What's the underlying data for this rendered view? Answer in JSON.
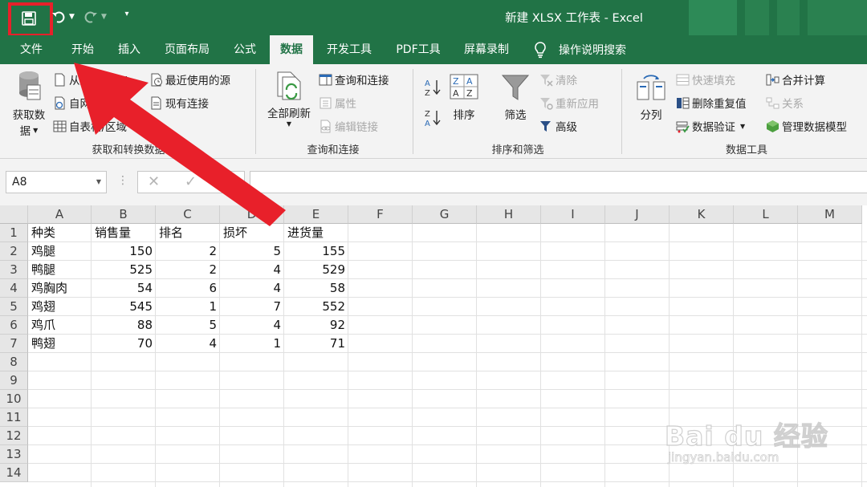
{
  "title_bar": {
    "title": "新建 XLSX 工作表 - Excel"
  },
  "menu": [
    {
      "label": "文件",
      "active": false
    },
    {
      "label": "开始",
      "active": false
    },
    {
      "label": "插入",
      "active": false
    },
    {
      "label": "页面布局",
      "active": false
    },
    {
      "label": "公式",
      "active": false
    },
    {
      "label": "数据",
      "active": true
    },
    {
      "label": "开发工具",
      "active": false
    },
    {
      "label": "PDF工具",
      "active": false
    },
    {
      "label": "屏幕录制",
      "active": false
    },
    {
      "label": "操作说明搜索",
      "active": false
    }
  ],
  "ribbon": {
    "get_data_group": {
      "label": "获取和转换数据",
      "get_data_line1": "获取数",
      "get_data_line2": "据",
      "from_text_csv": "从文本/CSV",
      "from_web": "自网站",
      "from_table": "自表格/区域",
      "recent_sources": "最近使用的源",
      "existing_connections": "现有连接"
    },
    "query_group": {
      "label": "查询和连接",
      "refresh_all": "全部刷新",
      "queries_connections": "查询和连接",
      "properties": "属性",
      "edit_links": "编辑链接"
    },
    "sort_group": {
      "label": "排序和筛选",
      "sort": "排序",
      "filter": "筛选",
      "clear": "清除",
      "reapply": "重新应用",
      "advanced": "高级"
    },
    "data_tools_group": {
      "label": "数据工具",
      "text_to_columns": "分列",
      "flash_fill": "快速填充",
      "remove_duplicates": "删除重复值",
      "data_validation": "数据验证",
      "consolidate": "合并计算",
      "relationships": "关系",
      "manage_data_model": "管理数据模型"
    }
  },
  "formula_bar": {
    "name_box": "A8",
    "formula": ""
  },
  "columns": [
    "A",
    "B",
    "C",
    "D",
    "E",
    "F",
    "G",
    "H",
    "I",
    "J",
    "K",
    "L",
    "M"
  ],
  "rows": [
    "1",
    "2",
    "3",
    "4",
    "5",
    "6",
    "7",
    "8",
    "9",
    "10",
    "11",
    "12",
    "13",
    "14"
  ],
  "table": {
    "headers": [
      "种类",
      "销售量",
      "排名",
      "损坏",
      "进货量"
    ],
    "rows": [
      [
        "鸡腿",
        "150",
        "2",
        "5",
        "155"
      ],
      [
        "鸭腿",
        "525",
        "2",
        "4",
        "529"
      ],
      [
        "鸡胸肉",
        "54",
        "6",
        "4",
        "58"
      ],
      [
        "鸡翅",
        "545",
        "1",
        "7",
        "552"
      ],
      [
        "鸡爪",
        "88",
        "5",
        "4",
        "92"
      ],
      [
        "鸭翅",
        "70",
        "4",
        "1",
        "71"
      ]
    ]
  },
  "watermark": {
    "brand": "Bai du 经验",
    "url": "jingyan.baidu.com"
  },
  "colors": {
    "excel_green": "#217346",
    "annotation_red": "#e8202a"
  },
  "icons": [
    "save-icon",
    "undo-icon",
    "redo-icon",
    "customize-icon",
    "lightbulb-icon"
  ]
}
